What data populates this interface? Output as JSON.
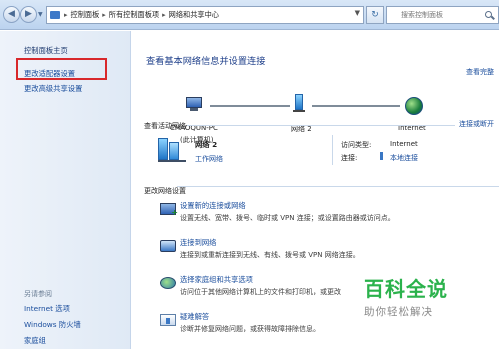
{
  "address": {
    "crumbs": [
      "控制面板",
      "所有控制面板项",
      "网络和共享中心"
    ],
    "search_placeholder": "搜索控制面板"
  },
  "sidebar": {
    "home": "控制面板主页",
    "items": [
      {
        "label": "更改适配器设置"
      },
      {
        "label": "更改高级共享设置"
      }
    ],
    "see_also_title": "另请参阅",
    "see_also": [
      "Internet 选项",
      "Windows 防火墙",
      "家庭组"
    ]
  },
  "main": {
    "title": "查看基本网络信息并设置连接",
    "view_full_map": "查看完整",
    "map": {
      "computer_name": "CHAOQUN-PC",
      "computer_sub": "(此计算机)",
      "network_name": "网络  2",
      "internet": "Internet"
    },
    "active_section": "查看活动网络",
    "connect_disconnect": "连接或断开",
    "active_network": {
      "name": "网络  2",
      "type": "工作网络",
      "access_type_label": "访问类型:",
      "access_type_value": "Internet",
      "connection_label": "连接:",
      "connection_value": "本地连接"
    },
    "change_section": "更改网络设置",
    "tasks": [
      {
        "title": "设置新的连接或网络",
        "desc": "设置无线、宽带、拨号、临时或 VPN 连接；或设置路由器或访问点。",
        "icon": "new-connection-icon"
      },
      {
        "title": "连接到网络",
        "desc": "连接到或重新连接到无线、有线、拨号或 VPN 网络连接。",
        "icon": "connect-network-icon"
      },
      {
        "title": "选择家庭组和共享选项",
        "desc": "访问位于其他网络计算机上的文件和打印机，或更改",
        "icon": "homegroup-icon"
      },
      {
        "title": "疑难解答",
        "desc": "诊断并修复网络问题，或获得故障排除信息。",
        "icon": "troubleshoot-icon"
      }
    ]
  },
  "watermark": {
    "logo": "百科全说",
    "sub": "助你轻松解决"
  }
}
